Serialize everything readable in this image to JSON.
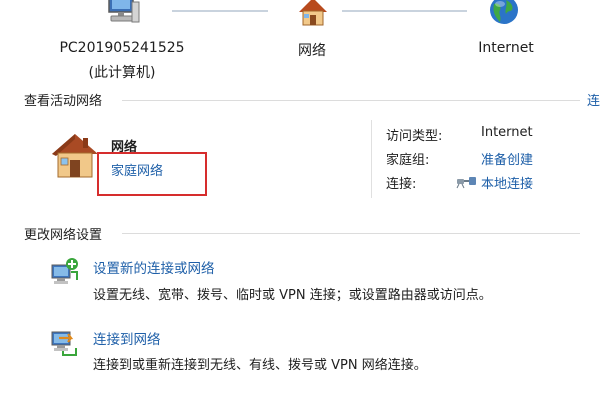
{
  "network_map": {
    "computer": {
      "name": "PC201905241525",
      "subtitle": "(此计算机)"
    },
    "network": {
      "name": "网络"
    },
    "internet": {
      "name": "Internet"
    }
  },
  "active_networks": {
    "title": "查看活动网络",
    "right_link": "连",
    "network_name": "网络",
    "network_type": "家庭网络",
    "access_type_label": "访问类型:",
    "access_type_value": "Internet",
    "homegroup_label": "家庭组:",
    "homegroup_value": "准备创建",
    "connections_label": "连接:",
    "connections_value": "本地连接"
  },
  "change_settings": {
    "title": "更改网络设置",
    "tasks": [
      {
        "title": "设置新的连接或网络",
        "description": "设置无线、宽带、拨号、临时或 VPN 连接；或设置路由器或访问点。"
      },
      {
        "title": "连接到网络",
        "description": "连接到或重新连接到无线、有线、拨号或 VPN 网络连接。"
      }
    ]
  },
  "colors": {
    "link": "#1e5fa8",
    "highlight_box": "#d62d2d",
    "divider": "#dcdcdc"
  },
  "icons": [
    "computer-icon",
    "house-icon",
    "globe-icon",
    "network-plug-icon",
    "setup-connection-icon",
    "connect-network-icon"
  ]
}
